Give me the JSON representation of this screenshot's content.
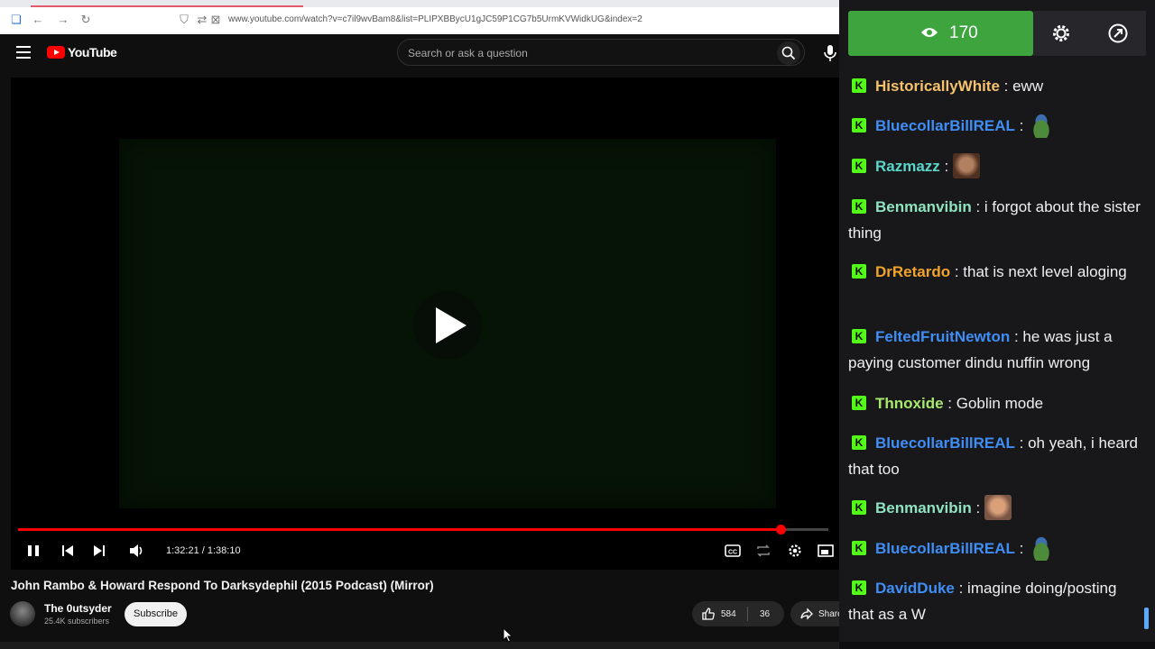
{
  "browser": {
    "url": "www.youtube.com/watch?v=c7il9wvBam8&list=PLIPXBBycU1gJC59P1CG7b5UrmKVWidkUG&index=2"
  },
  "youtube": {
    "logo_text": "YouTube",
    "search_placeholder": "Search or ask a question"
  },
  "player": {
    "current_time": "1:32:21",
    "duration": "1:38:10",
    "time_display": "1:32:21 / 1:38:10",
    "progress_fraction": 0.9408
  },
  "video": {
    "title": "John Rambo & Howard Respond To Darksydephil (2015 Podcast) (Mirror)",
    "channel": "The 0utsyder",
    "subscribers": "25.4K subscribers",
    "subscribe_label": "Subscribe",
    "likes": "584",
    "dislikes": "36",
    "share_label": "Share"
  },
  "chat": {
    "viewers": "170",
    "badge_letter": "K",
    "colors": {
      "viewer_bg": "#3ea53e",
      "badge": "#53fc18"
    },
    "messages": [
      {
        "user": "HistoricallyWhite",
        "color": "#f5c26b",
        "text": "eww",
        "emote": null
      },
      {
        "user": "BluecollarBillREAL",
        "color": "#3f8ef5",
        "text": "",
        "emote": "frog"
      },
      {
        "user": "Razmazz",
        "color": "#5bd6c9",
        "text": "",
        "emote": "face"
      },
      {
        "user": "Benmanvibin",
        "color": "#8fe3c0",
        "text": "i forgot about the sister thing",
        "emote": null
      },
      {
        "user": "DrRetardo",
        "color": "#f0a429",
        "text": "that is next level aloging",
        "emote": null
      },
      {
        "user": "FeltedFruitNewton",
        "color": "#3f8ef5",
        "text": "he was just a paying customer dindu nuffin wrong",
        "emote": null
      },
      {
        "user": "Thnoxide",
        "color": "#a8e86b",
        "text": "Goblin mode",
        "emote": null
      },
      {
        "user": "BluecollarBillREAL",
        "color": "#3f8ef5",
        "text": "oh yeah, i heard that too",
        "emote": null
      },
      {
        "user": "Benmanvibin",
        "color": "#8fe3c0",
        "text": "",
        "emote": "face2"
      },
      {
        "user": "BluecollarBillREAL",
        "color": "#3f8ef5",
        "text": "",
        "emote": "frog"
      },
      {
        "user": "DavidDuke",
        "color": "#3f8ef5",
        "text": "imagine doing/posting that as a W",
        "emote": null
      }
    ]
  }
}
